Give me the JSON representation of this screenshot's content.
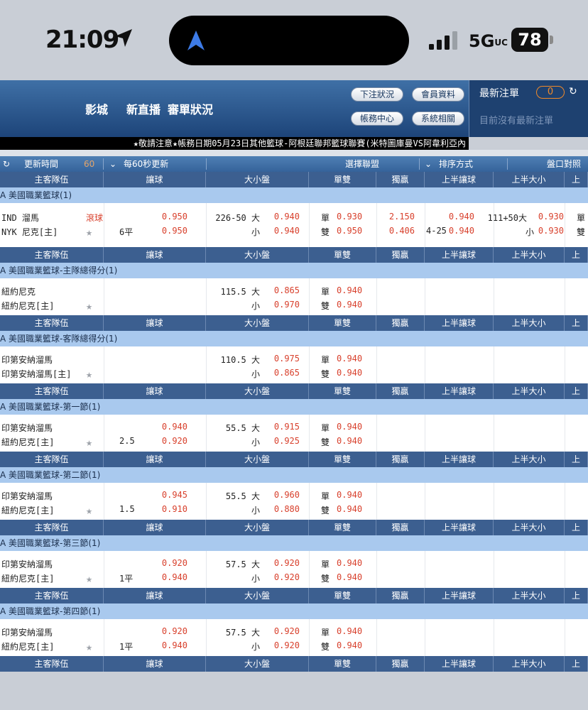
{
  "status": {
    "time": "21:09",
    "network": "5G",
    "network_suffix": "UC",
    "battery": "78",
    "colors": {
      "island": "#000000",
      "battery": "#111111"
    }
  },
  "header": {
    "links": [
      "影城",
      "新直播",
      "審單狀況"
    ],
    "buttons": {
      "bet_status": "下注狀況",
      "member_info": "會員資料",
      "account_center": "帳務中心",
      "system": "系統相關"
    },
    "latest_orders_title": "最新注單",
    "latest_orders_count": "0",
    "no_latest": "目前沒有最新注單",
    "colors": {
      "header": "#2a5690",
      "accent": "#f08a2a"
    }
  },
  "marquee": "★敬請注意★帳務日期05月23日其他籃球-阿根廷聯邦籃球聯賽(米特圖庫曼VS阿韋利亞內",
  "toolbar": {
    "update_time": "更新時間",
    "update_seconds": "60",
    "update_every": "每60秒更新",
    "select_league": "選擇聯盟",
    "sort_by": "排序方式",
    "handicap_table": "盤口對照表"
  },
  "columns": [
    "主客隊伍",
    "讓球",
    "大小盤",
    "單雙",
    "獨贏",
    "上半讓球",
    "上半大小",
    "上"
  ],
  "events": [
    {
      "league": "A 美國職業籃球(1)",
      "home": "IND 溜馬",
      "away": "NYK 尼克[主]",
      "live": "滾球",
      "line": "6平",
      "hdp_home": "0.950",
      "hdp_away": "0.950",
      "ou_line": "226-50 大",
      "ou_under": "小",
      "ou_over_odds": "0.940",
      "ou_under_odds": "0.940",
      "odd_label": "單",
      "even_label": "雙",
      "odd_odds": "0.930",
      "even_odds": "0.950",
      "ml_home": "2.150",
      "ml_away": "0.406",
      "h1_line": "4-25",
      "h1_home": "0.940",
      "h1_away": "0.940",
      "h1ou_line": "111+50大",
      "h1ou_under": "小",
      "h1ou_over": "0.930",
      "h1ou_under_odds": "0.930",
      "extra_odd": "單",
      "extra_even": "雙"
    },
    {
      "league": "A 美國職業籃球-主隊總得分(1)",
      "home": "紐約尼克",
      "away": "紐約尼克[主]",
      "ou_line": "115.5 大",
      "ou_under": "小",
      "ou_over_odds": "0.865",
      "ou_under_odds": "0.970",
      "odd_label": "單",
      "even_label": "雙",
      "odd_odds": "0.940",
      "even_odds": "0.940"
    },
    {
      "league": "A 美國職業籃球-客隊總得分(1)",
      "home": "印第安納溜馬",
      "away": "印第安納溜馬[主]",
      "ou_line": "110.5 大",
      "ou_under": "小",
      "ou_over_odds": "0.975",
      "ou_under_odds": "0.865",
      "odd_label": "單",
      "even_label": "雙",
      "odd_odds": "0.940",
      "even_odds": "0.940"
    },
    {
      "league": "A 美國職業籃球-第一節(1)",
      "home": "印第安納溜馬",
      "away": "紐約尼克[主]",
      "line": "2.5",
      "hdp_home": "0.940",
      "hdp_away": "0.920",
      "ou_line": "55.5 大",
      "ou_under": "小",
      "ou_over_odds": "0.915",
      "ou_under_odds": "0.925",
      "odd_label": "單",
      "even_label": "雙",
      "odd_odds": "0.940",
      "even_odds": "0.940"
    },
    {
      "league": "A 美國職業籃球-第二節(1)",
      "home": "印第安納溜馬",
      "away": "紐約尼克[主]",
      "line": "1.5",
      "hdp_home": "0.945",
      "hdp_away": "0.910",
      "ou_line": "55.5 大",
      "ou_under": "小",
      "ou_over_odds": "0.960",
      "ou_under_odds": "0.880",
      "odd_label": "單",
      "even_label": "雙",
      "odd_odds": "0.940",
      "even_odds": "0.940"
    },
    {
      "league": "A 美國職業籃球-第三節(1)",
      "home": "印第安納溜馬",
      "away": "紐約尼克[主]",
      "line": "1平",
      "hdp_home": "0.920",
      "hdp_away": "0.940",
      "ou_line": "57.5 大",
      "ou_under": "小",
      "ou_over_odds": "0.920",
      "ou_under_odds": "0.920",
      "odd_label": "單",
      "even_label": "雙",
      "odd_odds": "0.940",
      "even_odds": "0.940"
    },
    {
      "league": "A 美國職業籃球-第四節(1)",
      "home": "印第安納溜馬",
      "away": "紐約尼克[主]",
      "line": "1平",
      "hdp_home": "0.920",
      "hdp_away": "0.940",
      "ou_line": "57.5 大",
      "ou_under": "小",
      "ou_over_odds": "0.920",
      "ou_under_odds": "0.920",
      "odd_label": "單",
      "even_label": "雙",
      "odd_odds": "0.940",
      "even_odds": "0.940"
    }
  ]
}
